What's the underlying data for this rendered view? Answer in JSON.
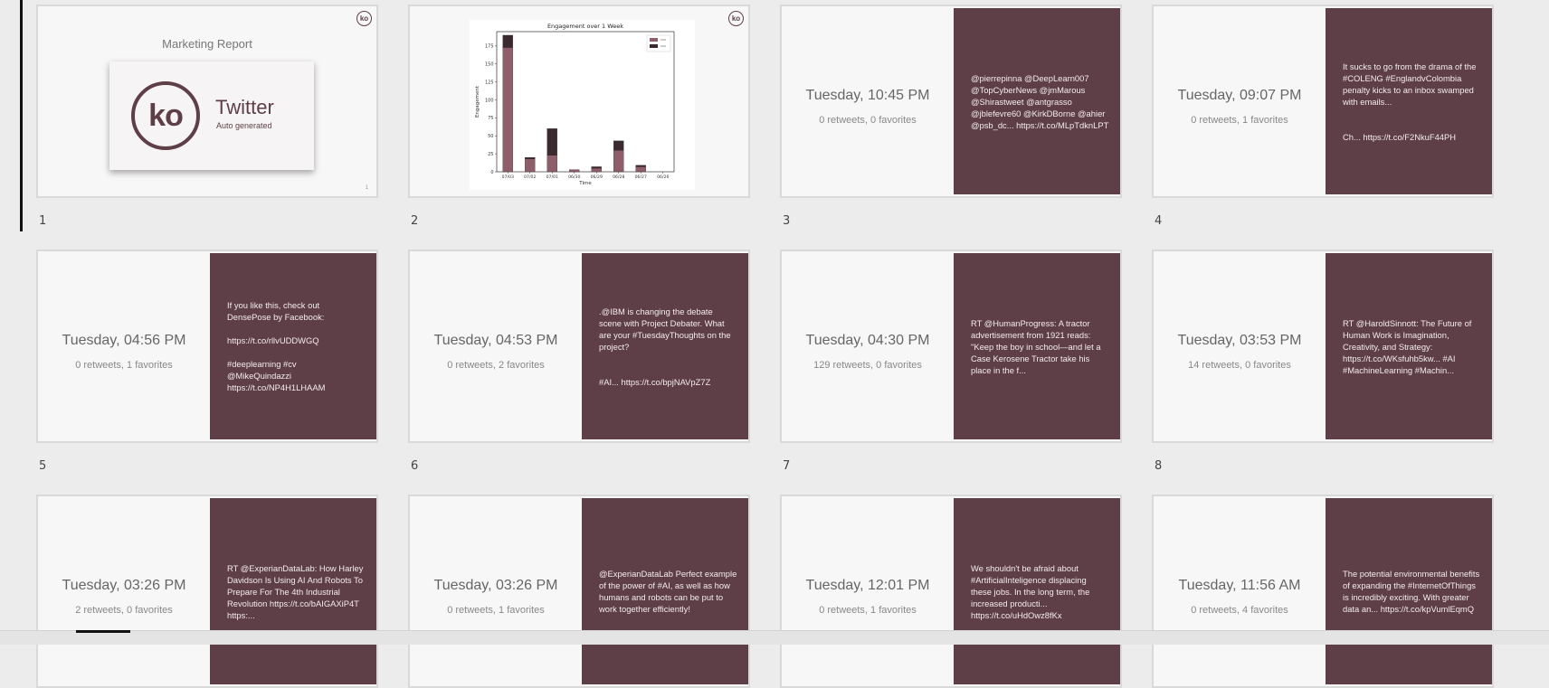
{
  "slides": [
    {
      "number": "1",
      "kind": "title",
      "heading": "Marketing Report",
      "logo_text": "ko",
      "title": "Twitter",
      "subtitle": "Auto generated",
      "page": "1",
      "badge": "ko"
    },
    {
      "number": "2",
      "kind": "chart",
      "badge": "ko"
    },
    {
      "number": "3",
      "kind": "tweet",
      "time": "Tuesday, 10:45 PM",
      "stats": "0 retweets, 0 favorites",
      "text": "@pierrepinna @DeepLearn007 @TopCyberNews @jmMarous @Shirastweet @antgrasso @jblefevre60 @KirkDBorne @ahier @psb_dc... https://t.co/MLpTdknLPT"
    },
    {
      "number": "4",
      "kind": "tweet",
      "time": "Tuesday, 09:07 PM",
      "stats": "0 retweets, 1 favorites",
      "text": "It sucks to go from the drama of the #COLENG #EnglandvColombia penalty kicks to an inbox swamped with emails...\n\n\nCh... https://t.co/F2NkuF44PH"
    },
    {
      "number": "5",
      "kind": "tweet",
      "time": "Tuesday, 04:56 PM",
      "stats": "0 retweets, 1 favorites",
      "text": "If you like this, check out DensePose by Facebook:\n\nhttps://t.co/rllvUDDWGQ\n\n#deeplearning #cv\n@MikeQuindazzi\nhttps://t.co/NP4H1LHAAM"
    },
    {
      "number": "6",
      "kind": "tweet",
      "time": "Tuesday, 04:53 PM",
      "stats": "0 retweets, 2 favorites",
      "text": ".@IBM is changing the debate scene with Project Debater. What are your  #TuesdayThoughts on the project?\n\n\n#AI... https://t.co/bpjNAVpZ7Z"
    },
    {
      "number": "7",
      "kind": "tweet",
      "time": "Tuesday, 04:30 PM",
      "stats": "129 retweets, 0 favorites",
      "text": "RT @HumanProgress: A tractor advertisement from 1921 reads: \"Keep the boy in school—and let a Case Kerosene Tractor take his place in the f..."
    },
    {
      "number": "8",
      "kind": "tweet",
      "time": "Tuesday, 03:53 PM",
      "stats": "14 retweets, 0 favorites",
      "text": "RT @HaroldSinnott: The Future of Human Work is Imagination, Creativity, and Strategy: https://t.co/WKsfuhb5kw... #AI #MachineLearning #Machin..."
    },
    {
      "number": "",
      "kind": "tweet",
      "time": "Tuesday, 03:26 PM",
      "stats": "2 retweets, 0 favorites",
      "text": "RT @ExperianDataLab: How Harley Davidson Is Using AI And Robots To Prepare For The 4th Industrial Revolution https://t.co/bAIGAXiP4T https:..."
    },
    {
      "number": "",
      "kind": "tweet",
      "time": "Tuesday, 03:26 PM",
      "stats": "0 retweets, 1 favorites",
      "text": "@ExperianDataLab Perfect example of the power of #AI, as well as how humans and robots can be put to work together efficiently!"
    },
    {
      "number": "",
      "kind": "tweet",
      "time": "Tuesday, 12:01 PM",
      "stats": "0 retweets, 1 favorites",
      "text": "We shouldn't be afraid about #ArtificialInteligence displacing these jobs. In the long term, the increased producti... https://t.co/uHdOwz8fKx"
    },
    {
      "number": "",
      "kind": "tweet",
      "time": "Tuesday, 11:56 AM",
      "stats": "0 retweets, 4 favorites",
      "text": "The potential environmental benefits of expanding the #InternetOfThings is incredibly exciting. With greater data an... https://t.co/kpVumlEqmQ"
    }
  ],
  "chart_data": {
    "type": "bar",
    "title": "Engagement over 1 Week",
    "xlabel": "Time",
    "ylabel": "Engagement",
    "categories": [
      "07/03",
      "07/02",
      "07/01",
      "06/30",
      "06/29",
      "06/28",
      "06/27",
      "06/26"
    ],
    "series": [
      {
        "values": [
          173,
          18,
          23,
          3,
          5,
          30,
          7,
          0
        ],
        "color": "#8e5f6a"
      },
      {
        "values": [
          17,
          2,
          37,
          0,
          2,
          13,
          2,
          0
        ],
        "color": "#3a2a2f"
      }
    ],
    "yticks": [
      0,
      25,
      50,
      75,
      100,
      125,
      150,
      175
    ],
    "ylim": [
      0,
      195
    ],
    "legend": "top-right",
    "grid": false
  },
  "colors": {
    "accent": "#5e3f47",
    "background": "#ececec"
  }
}
